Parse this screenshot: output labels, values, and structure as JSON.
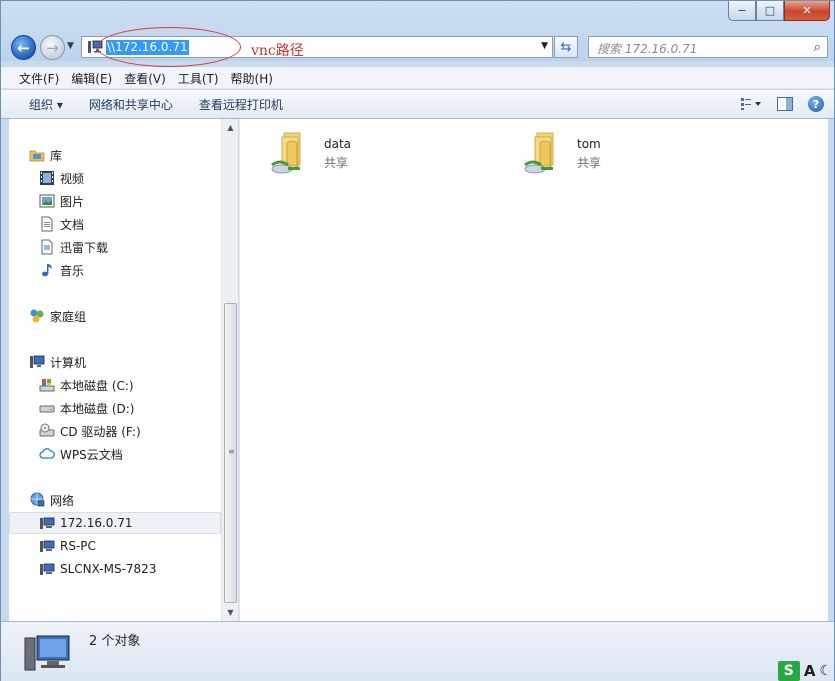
{
  "window": {
    "caption": {
      "minimize": "−",
      "maximize": "□",
      "close": "✕"
    }
  },
  "address_bar": {
    "path": "\\\\172.16.0.71",
    "annotation": "vnc路径"
  },
  "search": {
    "placeholder": "搜索 172.16.0.71"
  },
  "menubar": [
    {
      "label": "文件(F)"
    },
    {
      "label": "编辑(E)"
    },
    {
      "label": "查看(V)"
    },
    {
      "label": "工具(T)"
    },
    {
      "label": "帮助(H)"
    }
  ],
  "toolbar": {
    "organize": "组织 ▾",
    "network_center": "网络和共享中心",
    "printers": "查看远程打印机"
  },
  "nav": {
    "libraries": {
      "label": "库",
      "items": [
        {
          "label": "视频",
          "icon": "video-icon"
        },
        {
          "label": "图片",
          "icon": "picture-icon"
        },
        {
          "label": "文档",
          "icon": "document-icon"
        },
        {
          "label": "迅雷下载",
          "icon": "download-icon"
        },
        {
          "label": "音乐",
          "icon": "music-icon"
        }
      ]
    },
    "homegroup": {
      "label": "家庭组"
    },
    "computer": {
      "label": "计算机",
      "items": [
        {
          "label": "本地磁盘 (C:)"
        },
        {
          "label": "本地磁盘 (D:)"
        },
        {
          "label": "CD 驱动器 (F:)"
        },
        {
          "label": "WPS云文档"
        }
      ]
    },
    "network": {
      "label": "网络",
      "items": [
        {
          "label": "172.16.0.71"
        },
        {
          "label": "RS-PC"
        },
        {
          "label": "SLCNX-MS-7823"
        }
      ]
    }
  },
  "shares": [
    {
      "name": "data",
      "sub": "共享"
    },
    {
      "name": "tom",
      "sub": "共享"
    }
  ],
  "details": {
    "count": "2 个对象"
  },
  "tray": {
    "s": "S",
    "a": "A",
    "moon": "☾"
  }
}
